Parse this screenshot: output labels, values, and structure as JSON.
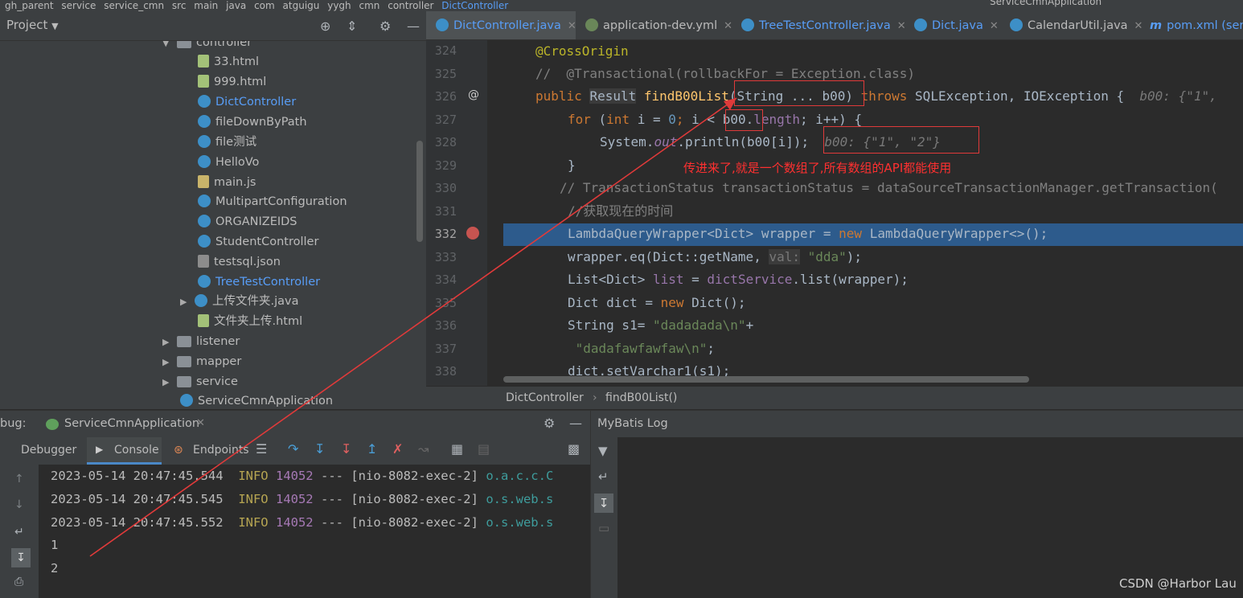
{
  "top_bar": {
    "breadcrumbs": [
      "gh_parent",
      "service",
      "service_cmn",
      "src",
      "main",
      "java",
      "com",
      "atguigu",
      "yygh",
      "cmn",
      "controller",
      "DictController"
    ],
    "run_config": "ServiceCmnApplication"
  },
  "project_panel": {
    "title": "Project",
    "tree": [
      {
        "label": "controller",
        "icon": "folder-icon",
        "expanded": true
      },
      {
        "label": "33.html",
        "icon": "html-file-icon"
      },
      {
        "label": "999.html",
        "icon": "html-file-icon"
      },
      {
        "label": "DictController",
        "icon": "class-icon",
        "highlight": true
      },
      {
        "label": "fileDownByPath",
        "icon": "class-icon"
      },
      {
        "label": "file测试",
        "icon": "class-icon"
      },
      {
        "label": "HelloVo",
        "icon": "class-icon"
      },
      {
        "label": "main.js",
        "icon": "js-file-icon"
      },
      {
        "label": "MultipartConfiguration",
        "icon": "class-icon"
      },
      {
        "label": "ORGANIZEIDS",
        "icon": "class-icon"
      },
      {
        "label": "StudentController",
        "icon": "class-icon"
      },
      {
        "label": "testsql.json",
        "icon": "json-file-icon"
      },
      {
        "label": "TreeTestController",
        "icon": "class-icon",
        "highlight": true
      },
      {
        "label": "上传文件夹.java",
        "icon": "class-icon"
      },
      {
        "label": "文件夹上传.html",
        "icon": "html-file-icon"
      },
      {
        "label": "listener",
        "icon": "folder-icon"
      },
      {
        "label": "mapper",
        "icon": "folder-icon"
      },
      {
        "label": "service",
        "icon": "folder-icon"
      },
      {
        "label": "ServiceCmnApplication",
        "icon": "class-icon"
      }
    ]
  },
  "editor": {
    "tabs": [
      {
        "label": "DictController.java",
        "active": true
      },
      {
        "label": "application-dev.yml"
      },
      {
        "label": "TreeTestController.java"
      },
      {
        "label": "Dict.java"
      },
      {
        "label": "CalendarUtil.java"
      },
      {
        "label": "pom.xml (serv"
      }
    ],
    "line_numbers": [
      "324",
      "325",
      "326",
      "327",
      "328",
      "329",
      "330",
      "331",
      "332",
      "333",
      "334",
      "335",
      "336",
      "337",
      "338"
    ],
    "lines": {
      "l324": "@CrossOrigin",
      "l325a": "//  ",
      "l325b": "@Transactional(rollbackFor = Exception.class)",
      "l326_public": "public ",
      "l326_result": "Result",
      "l326_sp": " ",
      "l326_fn": "findB00List",
      "l326_args": "(String ... b00) ",
      "l326_throws": "throws ",
      "l326_ex": "SQLException, IOException {  ",
      "l326_hint": "b00: {\"1\",",
      "l327_for": "for",
      "l327_a": " (",
      "l327_int": "int",
      "l327_b": " i = ",
      "l327_zero": "0",
      "l327_semi": "; ",
      "l327_c": "i < b00.",
      "l327_len": "length",
      "l327_d": "; i++) {",
      "l328_a": "System.",
      "l328_out": "out",
      "l328_b": ".println(b00[i]);  ",
      "l328_hint": "b00: {\"1\", \"2\"}",
      "l329": "}",
      "l330": "// TransactionStatus transactionStatus = dataSourceTransactionManager.getTransaction(",
      "l331": "//获取现在的时间",
      "l332_a": "LambdaQueryWrapper<Dict> wrapper = ",
      "l332_new": "new",
      "l332_b": " LambdaQueryWrapper<>();",
      "l333_a": "wrapper.eq(Dict::getName, ",
      "l333_hint": "val:",
      "l333_str": " \"dda\"",
      "l333_b": ");",
      "l334_a": "List<Dict> ",
      "l334_list": "list",
      "l334_b": " = ",
      "l334_svc": "dictService",
      "l334_c": ".list(wrapper);",
      "l335_a": "Dict dict = ",
      "l335_new": "new",
      "l335_b": " Dict();",
      "l336_a": "String s1= ",
      "l336_str": "\"dadadada\\n\"",
      "l336_b": "+",
      "l337_str": " \"dadafawfawfaw\\n\"",
      "l337_b": ";",
      "l338": "dict.setVarchar1(s1);"
    },
    "bottom_breadcrumb": [
      "DictController",
      "findB00List()"
    ]
  },
  "annotation_note": "传进来了,就是一个数组了,所有数组的API都能使用",
  "debug": {
    "title": "bug:",
    "session": "ServiceCmnApplication",
    "tabs": [
      "Debugger",
      "Console",
      "Endpoints"
    ],
    "console_lines": [
      {
        "ts": "2023-05-14 20:47:45.544",
        "level": "INFO",
        "pid": "14052",
        "sep": " --- ",
        "thread": "[nio-8082-exec-2]",
        "cls": "o.a.c.c.C"
      },
      {
        "ts": "2023-05-14 20:47:45.545",
        "level": "INFO",
        "pid": "14052",
        "sep": " --- ",
        "thread": "[nio-8082-exec-2]",
        "cls": "o.s.web.s"
      },
      {
        "ts": "2023-05-14 20:47:45.552",
        "level": "INFO",
        "pid": "14052",
        "sep": " --- ",
        "thread": "[nio-8082-exec-2]",
        "cls": "o.s.web.s"
      }
    ],
    "output": [
      "1",
      "2"
    ]
  },
  "mybatis": {
    "title": "MyBatis Log"
  },
  "watermark": "CSDN @Harbor Lau",
  "colors": {
    "accent": "#589df6",
    "highlight_line": "#2d5b8c",
    "annotation_red": "#e03a3a"
  }
}
